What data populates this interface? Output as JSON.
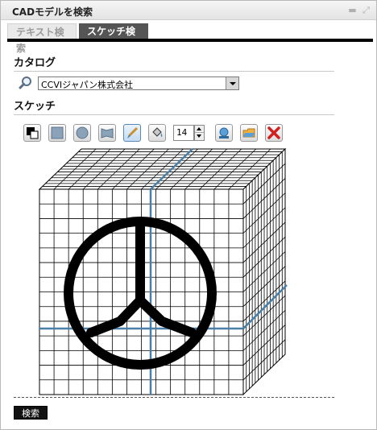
{
  "window": {
    "title": "CADモデルを検索"
  },
  "tabs": [
    {
      "label": "テキスト検索",
      "active": false
    },
    {
      "label": "スケッチ検索",
      "active": true
    }
  ],
  "catalog": {
    "heading": "カタログ",
    "selected": "CCVIジャパン株式会社"
  },
  "sketch": {
    "heading": "スケッチ",
    "toolbar": {
      "tools": [
        "color-picker-icon",
        "square-tool-icon",
        "circle-tool-icon",
        "flag-tool-icon",
        "brush-tool-icon",
        "fill-tool-icon"
      ],
      "selected_tool": "brush-tool-icon",
      "brush_size": "14",
      "extra_tools": [
        "import-icon",
        "open-folder-icon",
        "clear-icon"
      ]
    }
  },
  "colors": {
    "accent_blue": "#4a7fa8",
    "tab_active": "#555555",
    "clear_red": "#d02020"
  },
  "actions": {
    "search_label": "検索"
  }
}
